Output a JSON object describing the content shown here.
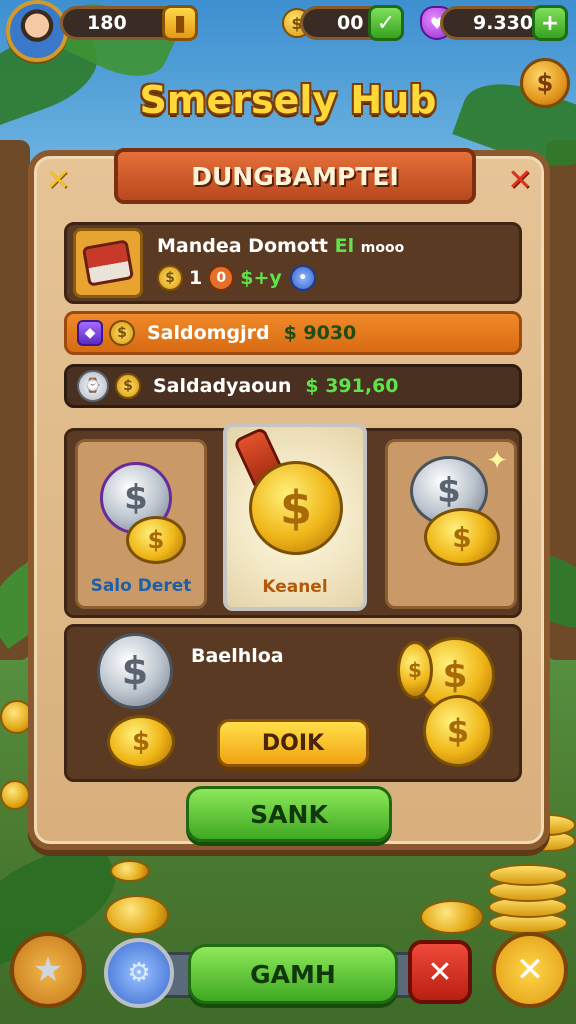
{
  "top_bar": {
    "avatar_icon": "player-avatar",
    "coins_value": "180",
    "coins_button_icon": "coin-slot-icon",
    "currency2_icon": "gold-shield-coin-icon",
    "currency2_value": "00",
    "currency2_button_icon": "check-icon",
    "gems_icon": "purple-gem-shield-icon",
    "gems_value": "9.330",
    "gems_add_icon": "plus-icon"
  },
  "title": "Smersely Hub",
  "corner_coin_symbol": "$",
  "panel": {
    "banner_title": "DUNGBAMPTEI",
    "close_icon_left": "close-x-icon",
    "close_icon_right": "close-x-icon",
    "chest_row": {
      "name": "Mandea Domott",
      "badge": "El",
      "tag": "mooo",
      "amount1": "1",
      "stat": "$+y",
      "coin_symbol": "$"
    },
    "row2": {
      "label": "Saldomgjrd",
      "value": "$ 9030"
    },
    "row3": {
      "label": "Saldadyaoun",
      "value": "$ 391,60"
    },
    "cards": [
      {
        "label": "Salo Deret",
        "label_color": "#1d5fa8"
      },
      {
        "label": "Keanel",
        "label_color": "#b35a0a"
      },
      {
        "label": "",
        "label_color": "#ffffff"
      }
    ],
    "bottom_box": {
      "label": "Baelhloa",
      "button": "DOIK"
    },
    "main_button": "SANK"
  },
  "bottom_bar": {
    "star_icon": "star-icon",
    "shield_icon": "shield-gear-icon",
    "main_button": "GAMH",
    "close_icon": "close-x-icon",
    "cancel_icon": "close-x-icon"
  },
  "colors": {
    "accent_gold": "#ffd83a",
    "green": "#5fe24a",
    "orange": "#d86a12",
    "wood": "#8a5a2e"
  }
}
